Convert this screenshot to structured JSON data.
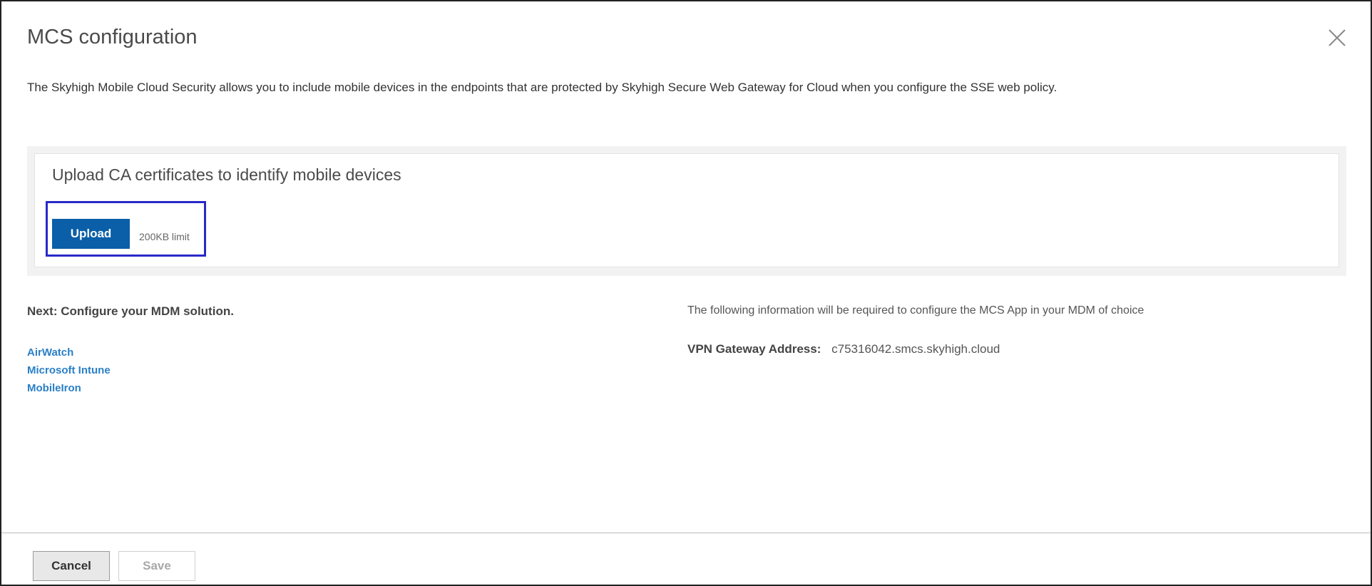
{
  "dialog": {
    "title": "MCS configuration",
    "close_icon": "close-icon",
    "description": "The Skyhigh Mobile Cloud Security allows you to include mobile devices in the endpoints that are protected by Skyhigh Secure Web Gateway for Cloud when you configure the SSE web policy."
  },
  "upload_section": {
    "heading": "Upload CA certificates to identify mobile devices",
    "upload_label": "Upload",
    "limit_text": "200KB limit",
    "highlight_color": "#2929c8",
    "button_color": "#0a5fa8"
  },
  "mdm": {
    "heading": "Next: Configure your MDM solution.",
    "links": [
      {
        "label": "AirWatch"
      },
      {
        "label": "Microsoft Intune"
      },
      {
        "label": "MobileIron"
      }
    ],
    "link_color": "#2a7fc7"
  },
  "info": {
    "text": "The following information will be required to configure the MCS App in your MDM of choice",
    "vpn_label": "VPN Gateway Address:",
    "vpn_value": "c75316042.smcs.skyhigh.cloud"
  },
  "footer": {
    "cancel_label": "Cancel",
    "save_label": "Save",
    "save_disabled": true
  }
}
